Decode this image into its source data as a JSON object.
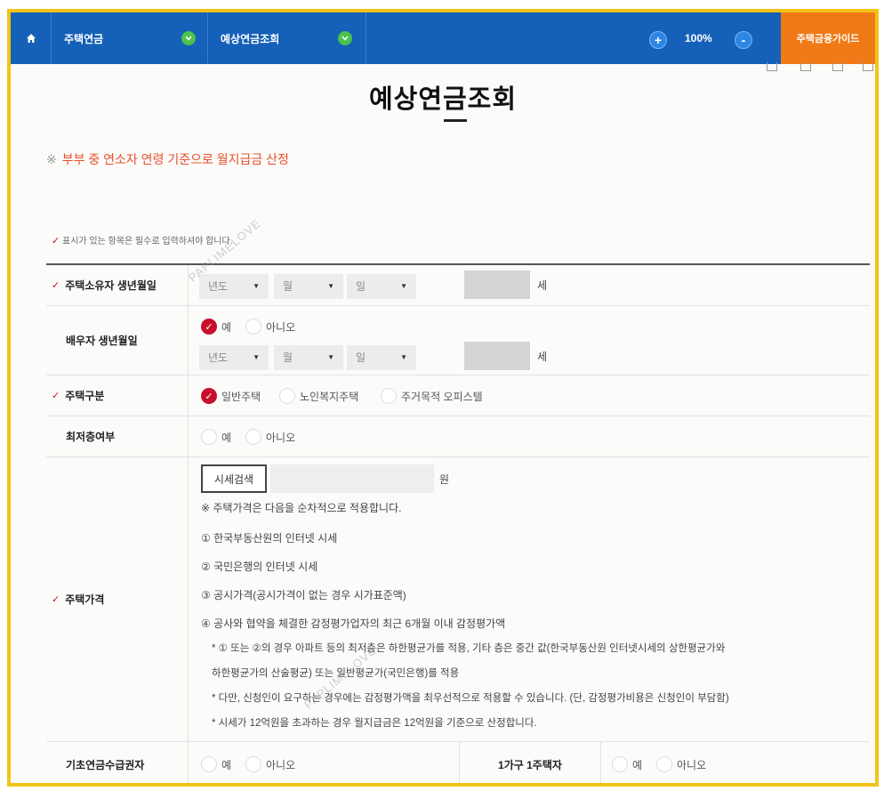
{
  "topbar": {
    "home_icon": "home-icon",
    "menu1": "주택연금",
    "menu2": "예상연금조회",
    "zoom_in": "+",
    "zoom_level": "100%",
    "zoom_out": "-",
    "guide": "주택금융가이드"
  },
  "page": {
    "title": "예상연금조회",
    "notice_mark": "※",
    "notice": "부부 중 연소자 연령 기준으로 월지급금 산정",
    "required_note": "표시가 있는 항목은 필수로 입력하셔야 합니다."
  },
  "form": {
    "owner_birth": {
      "label": "주택소유자 생년월일",
      "year": "년도",
      "month": "월",
      "day": "일",
      "age_unit": "세"
    },
    "spouse_birth": {
      "label": "배우자 생년월일",
      "yes": "예",
      "no": "아니오",
      "year": "년도",
      "month": "월",
      "day": "일",
      "age_unit": "세"
    },
    "house_type": {
      "label": "주택구분",
      "opt1": "일반주택",
      "opt2": "노인복지주택",
      "opt3": "주거목적 오피스텔"
    },
    "lowest_floor": {
      "label": "최저층여부",
      "yes": "예",
      "no": "아니오"
    },
    "house_price": {
      "label": "주택가격",
      "search_btn": "시세검색",
      "unit": "원",
      "lines": [
        "※ 주택가격은 다음을 순차적으로 적용합니다.",
        "① 한국부동산원의 인터넷 시세",
        "② 국민은행의 인터넷 시세",
        "③ 공시가격(공시가격이 없는 경우 시가표준액)",
        "④ 공사와 협약을 체결한 감정평가업자의 최근 6개월 이내 감정평가액"
      ],
      "sublines": [
        "* ① 또는 ②의 경우 아파트 등의 최저층은 하한평균가를 적용, 기타 층은 중간 값(한국부동산원 인터넷시세의 상한평균가와",
        "하한평균가의 산술평균) 또는 일반평균가(국민은행)를 적용",
        "* 다만, 신청인이 요구하는 경우에는 감정평가액을 최우선적으로 적용할 수 있습니다. (단, 감정평가비용은 신청인이 부담함)",
        "* 시세가 12억원을 초과하는 경우 월지급금은 12억원을 기준으로 산정합니다."
      ]
    },
    "basic_pension": {
      "label": "기초연금수급권자",
      "yes": "예",
      "no": "아니오"
    },
    "one_house": {
      "label": "1가구 1주택자",
      "yes": "예",
      "no": "아니오"
    }
  },
  "watermark": "PAPLIMELOVE"
}
